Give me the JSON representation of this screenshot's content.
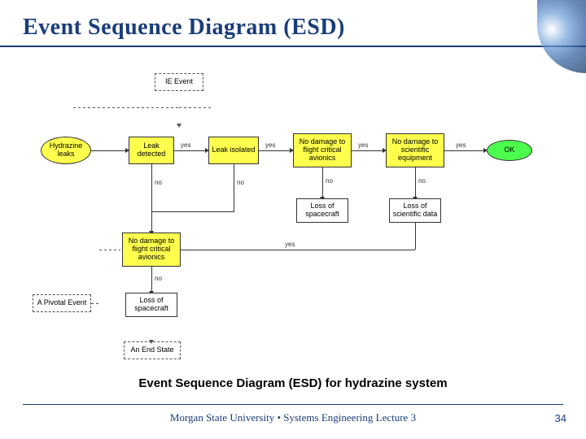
{
  "title": "Event Sequence Diagram (ESD)",
  "caption": "Event Sequence Diagram (ESD) for hydrazine system",
  "footer": "Morgan State University • Systems Engineering Lecture 3",
  "page_num": "34",
  "nodes": {
    "ie_event": "IE Event",
    "hydrazine_leaks": "Hydrazine leaks",
    "leak_detected": "Leak detected",
    "leak_isolated": "Leak isolated",
    "no_damage_avionics_top": "No damage to flight critical avionics",
    "no_damage_scientific": "No damage to scientific equipment",
    "ok": "OK",
    "loss_spacecraft_top": "Loss of spacecraft",
    "loss_scientific": "Loss of scientific data",
    "no_damage_avionics_bot": "No damage to flight critical avionics",
    "loss_spacecraft_bot": "Loss of spacecraft",
    "pivotal_event": "A Pivotal Event",
    "end_state": "An End State"
  },
  "labels": {
    "yes": "yes",
    "no": "no"
  }
}
